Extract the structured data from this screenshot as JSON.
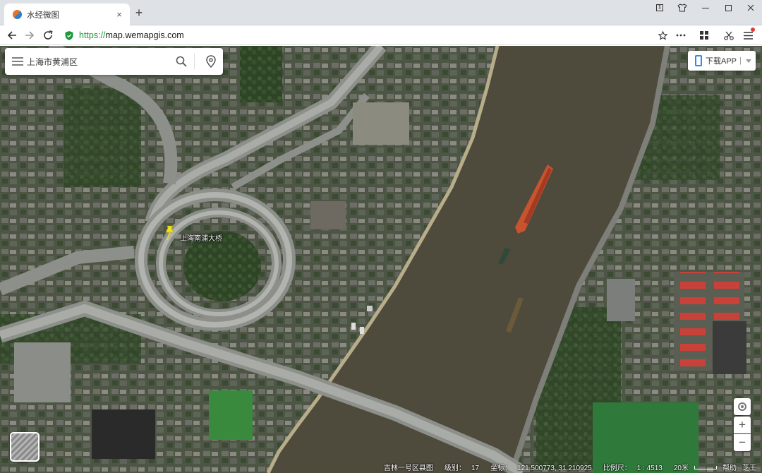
{
  "browser": {
    "tab_title": "水经微图",
    "tab_close": "×",
    "new_tab": "+",
    "url_scheme": "https://",
    "url_host": "map.wemapgis.com"
  },
  "map": {
    "search": {
      "value": "上海市黄浦区"
    },
    "app_download": {
      "label": "下载APP",
      "separator": "|"
    },
    "marker": {
      "label": "上海南浦大桥"
    },
    "controls": {
      "zoom_in": "+",
      "zoom_out": "−"
    },
    "status": {
      "source": "吉林一号区县图",
      "level_label": "级别：",
      "level": "17",
      "coord_label": "坐标：",
      "coords": "121.500773, 31.210925",
      "scale_label": "比例尺：",
      "scale": "1 : 4513",
      "scale_bar": "20米",
      "help": "帮助",
      "user": "芝王"
    }
  },
  "icons": [
    "app-favicon",
    "back-arrow-icon",
    "forward-arrow-icon",
    "reload-icon",
    "secure-shield-icon",
    "star-icon",
    "more-icon",
    "extensions-icon",
    "scissors-icon",
    "menu-icon",
    "hamburger-icon",
    "search-icon",
    "location-pin-icon",
    "phone-icon",
    "locate-icon",
    "layer-icon"
  ],
  "colors": {
    "secure": "#1a9a3a",
    "accent": "#2e8be8",
    "marker": "#f2e21a",
    "river": "#4e4a3c"
  }
}
